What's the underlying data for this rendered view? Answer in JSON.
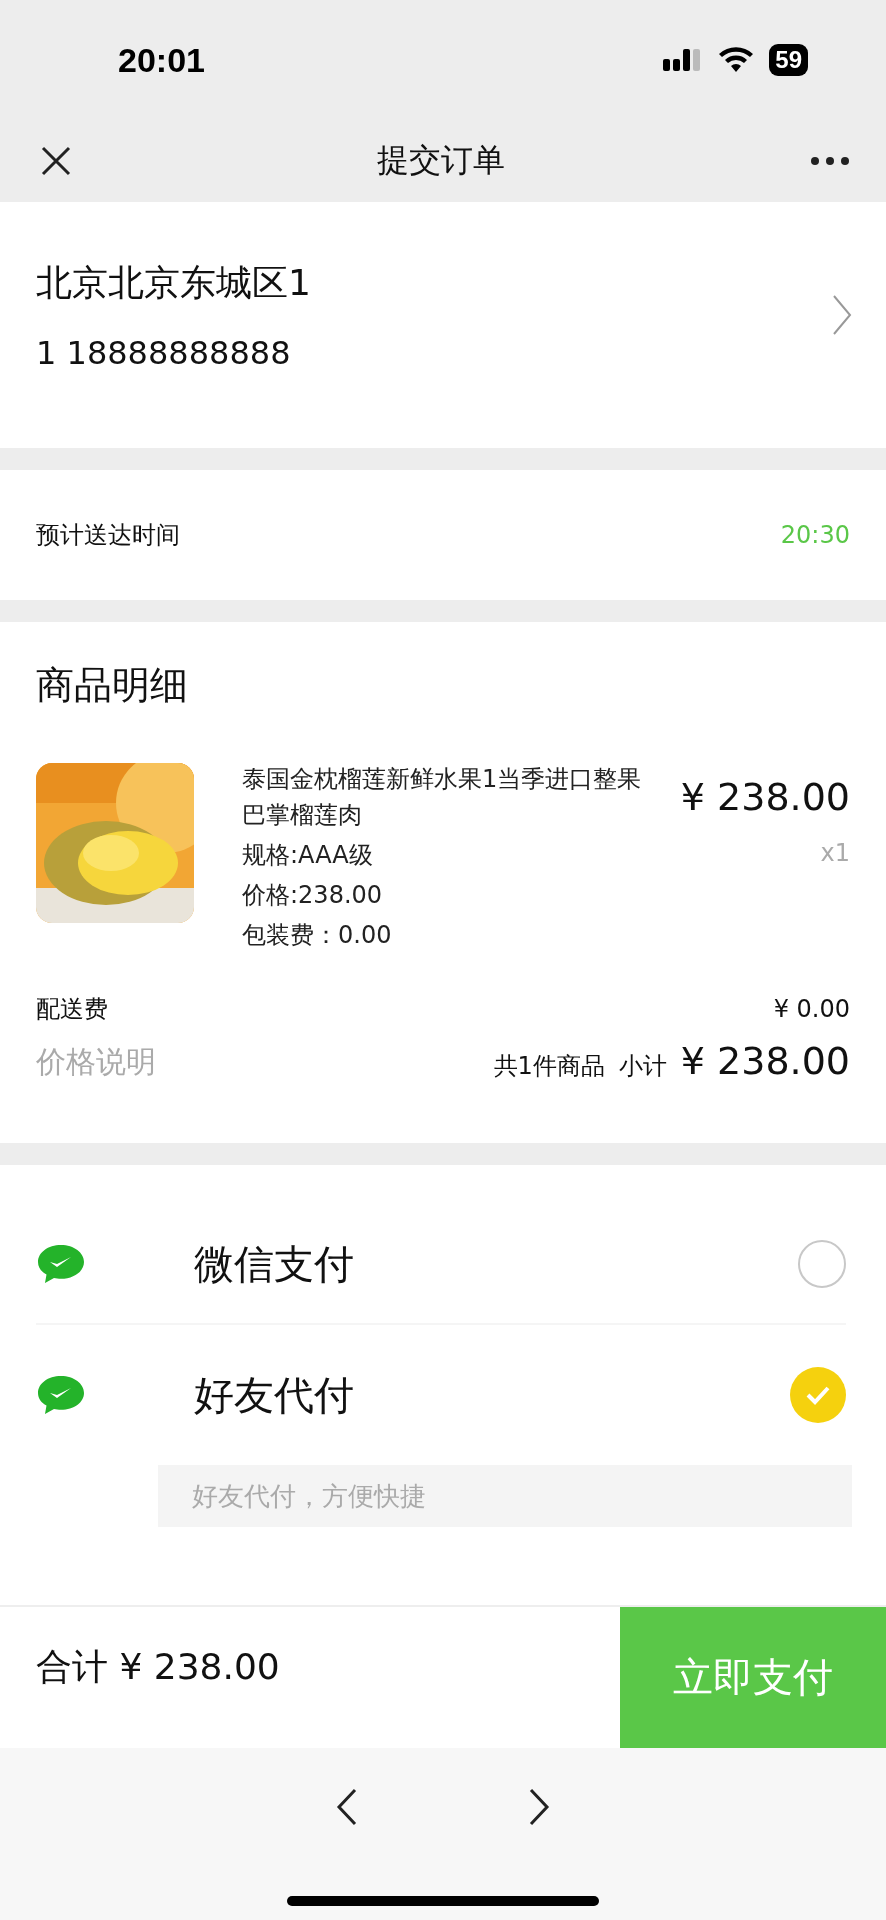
{
  "status_bar": {
    "time": "20:01",
    "battery": "59"
  },
  "nav_bar": {
    "title": "提交订单"
  },
  "address": {
    "line": "北京北京东城区1",
    "contact": "1 18888888888"
  },
  "delivery": {
    "label": "预计送达时间",
    "time": "20:30"
  },
  "goods": {
    "title": "商品明细",
    "items": [
      {
        "name": "泰国金枕榴莲新鲜水果1当季进口整果巴掌榴莲肉",
        "spec": "规格:AAA级",
        "price_line": "价格:238.00",
        "packing": "包装费：0.00",
        "price": "¥ 238.00",
        "qty": "x1"
      }
    ],
    "shipping_label": "配送费",
    "shipping_fee": "¥ 0.00",
    "price_note": "价格说明",
    "count": "共1件商品",
    "subtotal_label": "小计",
    "subtotal": "¥ 238.00"
  },
  "payment_methods": [
    {
      "label": "微信支付",
      "selected": false
    },
    {
      "label": "好友代付",
      "selected": true,
      "message_placeholder": "好友代付，方便快捷"
    }
  ],
  "footer": {
    "total_label": "合计",
    "total": "¥ 238.00",
    "pay_button": "立即支付"
  }
}
